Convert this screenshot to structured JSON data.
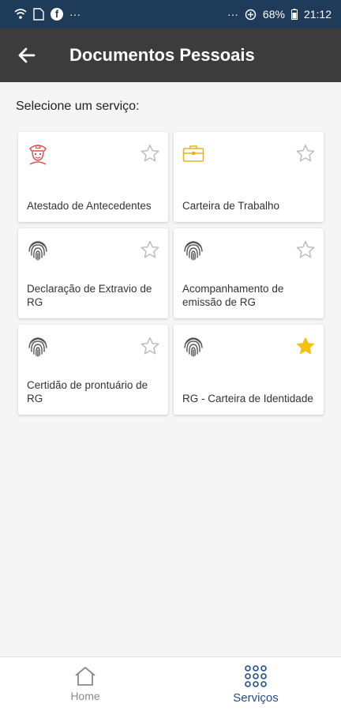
{
  "statusbar": {
    "left_icons": [
      "wifi-question-icon",
      "file-icon",
      "facebook-icon",
      "more-icon"
    ],
    "more": "···",
    "battery": "68%",
    "time": "21:12"
  },
  "header": {
    "title": "Documentos Pessoais",
    "back_icon": "arrow-left-icon"
  },
  "main": {
    "prompt": "Selecione um serviço:",
    "services": [
      {
        "label": "Atestado de Antecedentes",
        "icon": "police-officer-icon",
        "favorite": false
      },
      {
        "label": "Carteira de Trabalho",
        "icon": "briefcase-icon",
        "favorite": false
      },
      {
        "label": "Declaração de Extravio de RG",
        "icon": "fingerprint-icon",
        "favorite": false
      },
      {
        "label": "Acompanhamento de emissão de RG",
        "icon": "fingerprint-icon",
        "favorite": false
      },
      {
        "label": "Certidão de prontuário de RG",
        "icon": "fingerprint-icon",
        "favorite": false
      },
      {
        "label": "RG - Carteira de Identidade",
        "icon": "fingerprint-icon",
        "favorite": true
      }
    ]
  },
  "bottom_nav": {
    "home_label": "Home",
    "services_label": "Serviços"
  },
  "colors": {
    "statusbar": "#1f3b5a",
    "appbar": "#3c3c3c",
    "police_icon": "#d9534f",
    "briefcase_icon": "#e6b422",
    "star_active": "#f4c20d",
    "nav_active": "#1f4c8c"
  }
}
